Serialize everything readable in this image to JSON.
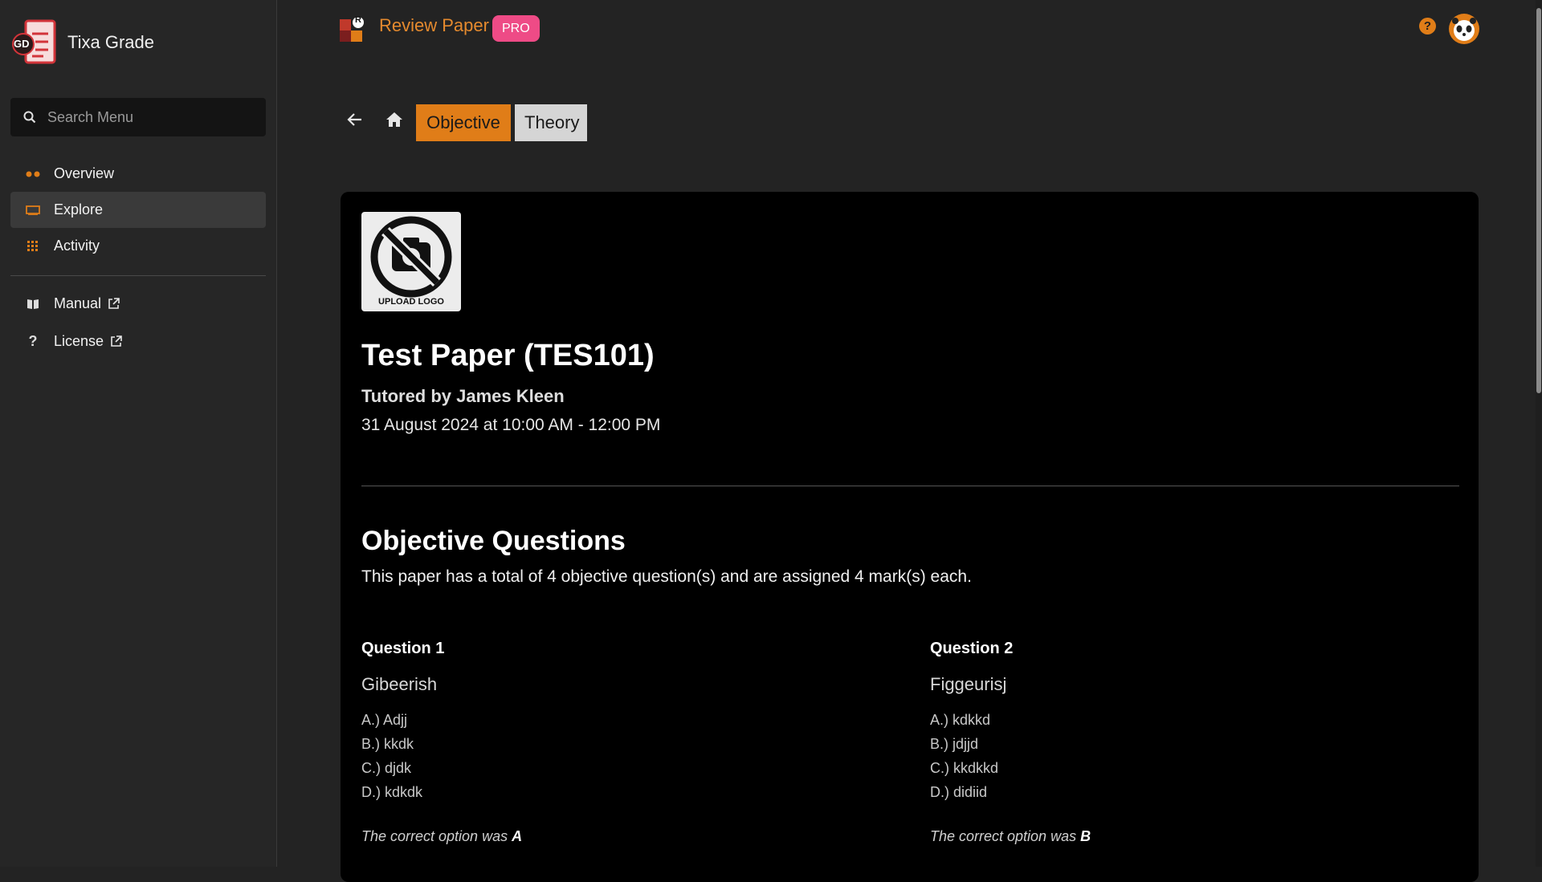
{
  "sidebar": {
    "brand_initials": "GD",
    "brand_name": "Tixa Grade",
    "search_placeholder": "Search Menu",
    "items": [
      {
        "label": "Overview",
        "icon": "dots-icon"
      },
      {
        "label": "Explore",
        "icon": "monitor-icon"
      },
      {
        "label": "Activity",
        "icon": "grid-icon"
      }
    ],
    "links": [
      {
        "label": "Manual",
        "icon": "book-icon"
      },
      {
        "label": "License",
        "icon": "question-icon"
      }
    ]
  },
  "header": {
    "logo_letter": "R",
    "title": "Review Paper",
    "badge": "PRO",
    "help": "?"
  },
  "toolbar": {
    "tabs": [
      {
        "label": "Objective",
        "active": true
      },
      {
        "label": "Theory",
        "active": false
      }
    ]
  },
  "paper": {
    "upload_label": "UPLOAD LOGO",
    "title": "Test Paper (TES101)",
    "tutor": "Tutored by James Kleen",
    "datetime": "31 August 2024 at 10:00 AM - 12:00 PM"
  },
  "objective": {
    "heading": "Objective Questions",
    "description": "This paper has a total of 4 objective question(s) and are assigned 4 mark(s) each.",
    "answer_prefix": "The correct option was",
    "questions": [
      {
        "label": "Question 1",
        "text": "Gibeerish",
        "options": [
          "A.) Adjj",
          "B.) kkdk",
          "C.) djdk",
          "D.) kdkdk"
        ],
        "correct": "A"
      },
      {
        "label": "Question 2",
        "text": "Figgeurisj",
        "options": [
          "A.) kdkkd",
          "B.) jdjjd",
          "C.) kkdkkd",
          "D.) didiid"
        ],
        "correct": "B"
      }
    ]
  },
  "colors": {
    "accent": "#e07d18",
    "badge": "#ee4b86",
    "background": "#232323",
    "card": "#000000"
  }
}
